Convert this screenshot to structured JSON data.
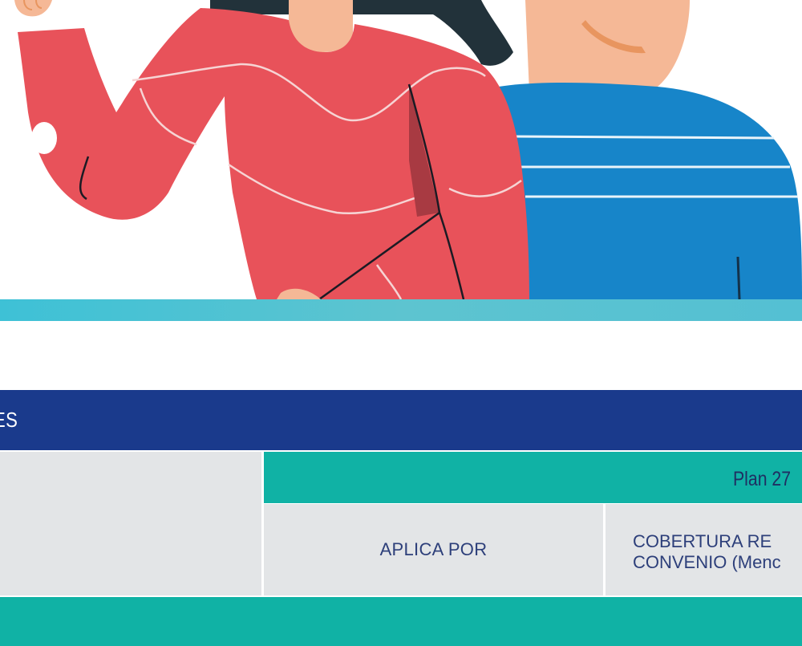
{
  "table": {
    "header_text": "ES",
    "plan_label": "Plan 27",
    "columns": {
      "aplica_label": "APLICA POR",
      "cobertura_line1": "COBERTURA RE",
      "cobertura_line2": "CONVENIO (Menc"
    }
  },
  "colors": {
    "header_navy": "#1a3a8c",
    "teal": "#10b2a5",
    "cell_gray": "#e3e5e7",
    "stripe_cyan": "#4fc3d4",
    "sweater_red": "#e8525a",
    "sweater_blue": "#1785c9",
    "skin": "#f5b896",
    "hair": "#22323a"
  },
  "illustration": {
    "figures": [
      "woman-red-sweater",
      "man-blue-sweater"
    ]
  }
}
